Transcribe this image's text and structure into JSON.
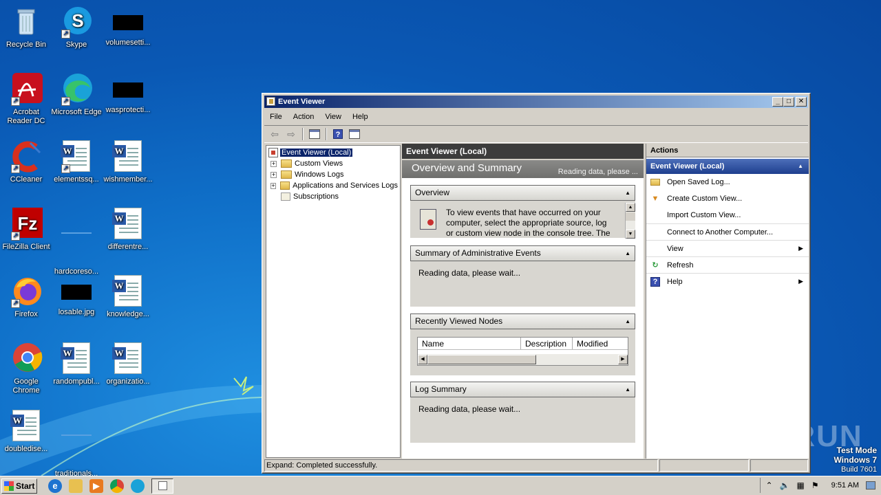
{
  "desktop": {
    "icons": [
      {
        "label": "Recycle Bin",
        "icon": "recycle-bin-icon"
      },
      {
        "label": "Skype",
        "icon": "skype-icon"
      },
      {
        "label": "volumesetti...",
        "icon": "black-thumbnail-icon"
      },
      {
        "label": "Acrobat Reader DC",
        "icon": "acrobat-icon"
      },
      {
        "label": "Microsoft Edge",
        "icon": "edge-icon"
      },
      {
        "label": "wasprotecti...",
        "icon": "black-thumbnail-icon"
      },
      {
        "label": "CCleaner",
        "icon": "ccleaner-icon"
      },
      {
        "label": "elementssq...",
        "icon": "word-doc-icon"
      },
      {
        "label": "wishmember...",
        "icon": "word-doc-icon"
      },
      {
        "label": "FileZilla Client",
        "icon": "filezilla-icon"
      },
      {
        "label": "hardcoreso...",
        "icon": "blank-thumbnail-icon"
      },
      {
        "label": "differentre...",
        "icon": "word-doc-icon"
      },
      {
        "label": "Firefox",
        "icon": "firefox-icon"
      },
      {
        "label": "losable.jpg",
        "icon": "black-thumbnail-icon"
      },
      {
        "label": "knowledge...",
        "icon": "word-doc-icon"
      },
      {
        "label": "Google Chrome",
        "icon": "chrome-icon"
      },
      {
        "label": "randompubl...",
        "icon": "word-doc-icon"
      },
      {
        "label": "organizatio...",
        "icon": "word-doc-icon"
      },
      {
        "label": "doubledise...",
        "icon": "word-doc-icon"
      },
      {
        "label": "traditionals...",
        "icon": "blank-thumbnail-icon"
      }
    ]
  },
  "window": {
    "title": "Event Viewer",
    "menu": [
      "File",
      "Action",
      "View",
      "Help"
    ],
    "tree": {
      "root": "Event Viewer (Local)",
      "items": [
        "Custom Views",
        "Windows Logs",
        "Applications and Services Logs",
        "Subscriptions"
      ]
    },
    "center": {
      "header": "Event Viewer (Local)",
      "banner_title": "Overview and Summary",
      "banner_status": "Reading data, please ...",
      "overview": {
        "title": "Overview",
        "text": "To view events that have occurred on your computer, select the appropriate source, log or custom view node in the console tree. The"
      },
      "admin_events": {
        "title": "Summary of Administrative Events",
        "body": "Reading data, please wait..."
      },
      "recent_nodes": {
        "title": "Recently Viewed Nodes",
        "columns": [
          "Name",
          "Description",
          "Modified"
        ]
      },
      "log_summary": {
        "title": "Log Summary",
        "body": "Reading data, please wait..."
      }
    },
    "actions": {
      "header": "Actions",
      "group": "Event Viewer (Local)",
      "items": [
        {
          "label": "Open Saved Log...",
          "icon": "folder-open-icon"
        },
        {
          "label": "Create Custom View...",
          "icon": "funnel-icon"
        },
        {
          "label": "Import Custom View...",
          "icon": ""
        },
        {
          "label": "Connect to Another Computer...",
          "icon": ""
        },
        {
          "label": "View",
          "icon": "",
          "submenu": true
        },
        {
          "label": "Refresh",
          "icon": "refresh-icon"
        },
        {
          "label": "Help",
          "icon": "help-icon",
          "submenu": true
        }
      ]
    },
    "status": "Expand:  Completed successfully."
  },
  "taskbar": {
    "start_label": "Start",
    "clock": "9:51 AM"
  },
  "watermark": {
    "line1": "Test Mode",
    "line2": "Windows 7",
    "line3": "Build 7601",
    "brand": "ANY RUN"
  },
  "colors": {
    "title_gradient_start": "#0a246a",
    "title_gradient_end": "#a6caf0",
    "actions_group": "#1e3f8e",
    "desktop_bg": "#0a58b4"
  }
}
